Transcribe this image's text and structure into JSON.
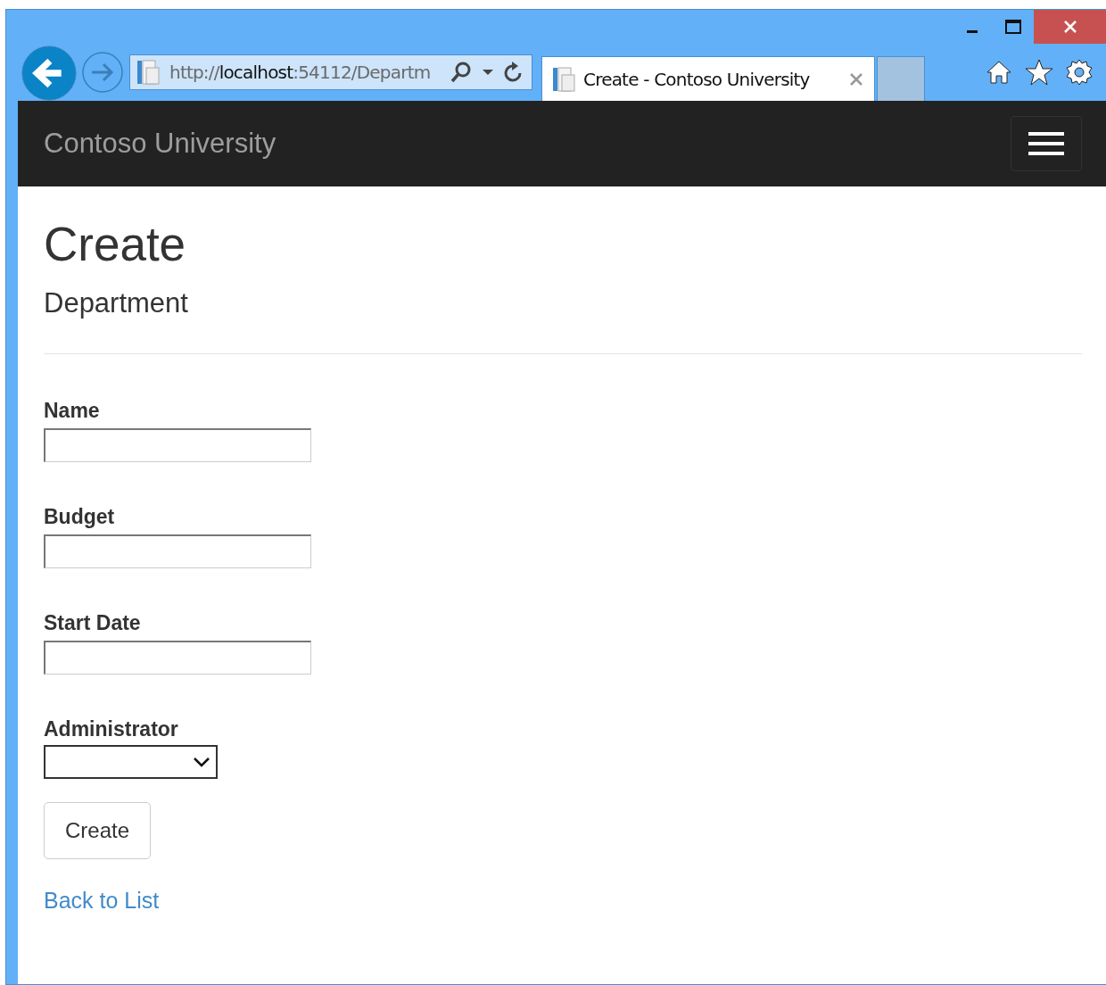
{
  "browser": {
    "address": {
      "scheme": "http://",
      "host": "localhost",
      "rest": ":54112/Departm"
    },
    "tabs": [
      {
        "title": "Create - Contoso University",
        "selected": true
      },
      {
        "selected": false
      }
    ]
  },
  "navbar": {
    "brand": "Contoso University"
  },
  "page": {
    "title": "Create",
    "subtitle": "Department",
    "fields": [
      {
        "label": "Name",
        "kind": "text"
      },
      {
        "label": "Budget",
        "kind": "text"
      },
      {
        "label": "Start Date",
        "kind": "text"
      },
      {
        "label": "Administrator",
        "kind": "select"
      }
    ],
    "submit": "Create",
    "back_link": "Back to List"
  }
}
